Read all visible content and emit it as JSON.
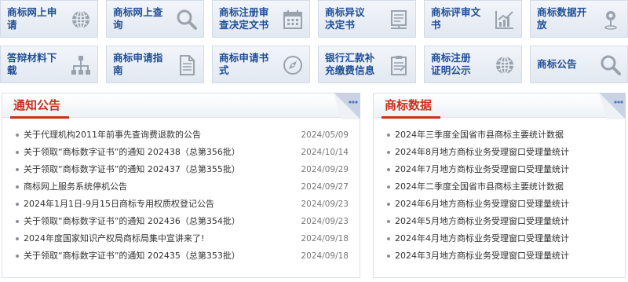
{
  "tiles": [
    {
      "label": "商标网上申请",
      "icon": "globe-icon"
    },
    {
      "label": "商标网上查询",
      "icon": "magnifier-icon"
    },
    {
      "label": "商标注册审\n查决定文书",
      "icon": "calendar-icon"
    },
    {
      "label": "商标异议\n决定书",
      "icon": "document-stand-icon"
    },
    {
      "label": "商标评审文书",
      "icon": "trend-chart-icon"
    },
    {
      "label": "商标数据开放",
      "icon": "map-pin-icon"
    },
    {
      "label": "答辩材料下载",
      "icon": "org-chart-icon"
    },
    {
      "label": "商标申请指南",
      "icon": "document-icon"
    },
    {
      "label": "商标申请书式",
      "icon": "compass-icon"
    },
    {
      "label": "银行汇款补\n充缴费信息",
      "icon": "clipboard-icon"
    },
    {
      "label": "商标注册\n证明公示",
      "icon": "globe-icon"
    },
    {
      "label": "商标公告",
      "icon": "magnifier-icon"
    }
  ],
  "notice": {
    "title": "通知公告",
    "more_icon": "more-dots-icon",
    "items": [
      {
        "text": "关于代理机构2011年前事先查询费退款的公告",
        "date": "2024/05/09"
      },
      {
        "text": "关于领取“商标数字证书”的通知 202438（总第356批）",
        "date": "2024/10/14"
      },
      {
        "text": "关于领取“商标数字证书”的通知 202437（总第355批）",
        "date": "2024/09/29"
      },
      {
        "text": "商标网上服务系统停机公告",
        "date": "2024/09/27"
      },
      {
        "text": "2024年1月1日-9月15日商标专用权质权登记公告",
        "date": "2024/09/23"
      },
      {
        "text": "关于领取“商标数字证书”的通知 202436（总第354批）",
        "date": "2024/09/23"
      },
      {
        "text": "2024年度国家知识产权局商标局集中宣讲来了!",
        "date": "2024/09/18"
      },
      {
        "text": "关于领取“商标数字证书”的通知 202435（总第353批）",
        "date": "2024/09/18"
      }
    ]
  },
  "data": {
    "title": "商标数据",
    "more_icon": "more-dots-icon",
    "items": [
      {
        "text": "2024年三季度全国省市县商标主要统计数据"
      },
      {
        "text": "2024年8月地方商标业务受理窗口受理量统计"
      },
      {
        "text": "2024年7月地方商标业务受理窗口受理量统计"
      },
      {
        "text": "2024年二季度全国省市县商标主要统计数据"
      },
      {
        "text": "2024年6月地方商标业务受理窗口受理量统计"
      },
      {
        "text": "2024年5月地方商标业务受理窗口受理量统计"
      },
      {
        "text": "2024年4月地方商标业务受理窗口受理量统计"
      },
      {
        "text": "2024年3月地方商标业务受理窗口受理量统计"
      }
    ]
  },
  "colors": {
    "tile_text": "#1d4d97",
    "icon": "#9aa3ad",
    "panel_title": "#c8301e",
    "corner": "#c9d3e3"
  }
}
